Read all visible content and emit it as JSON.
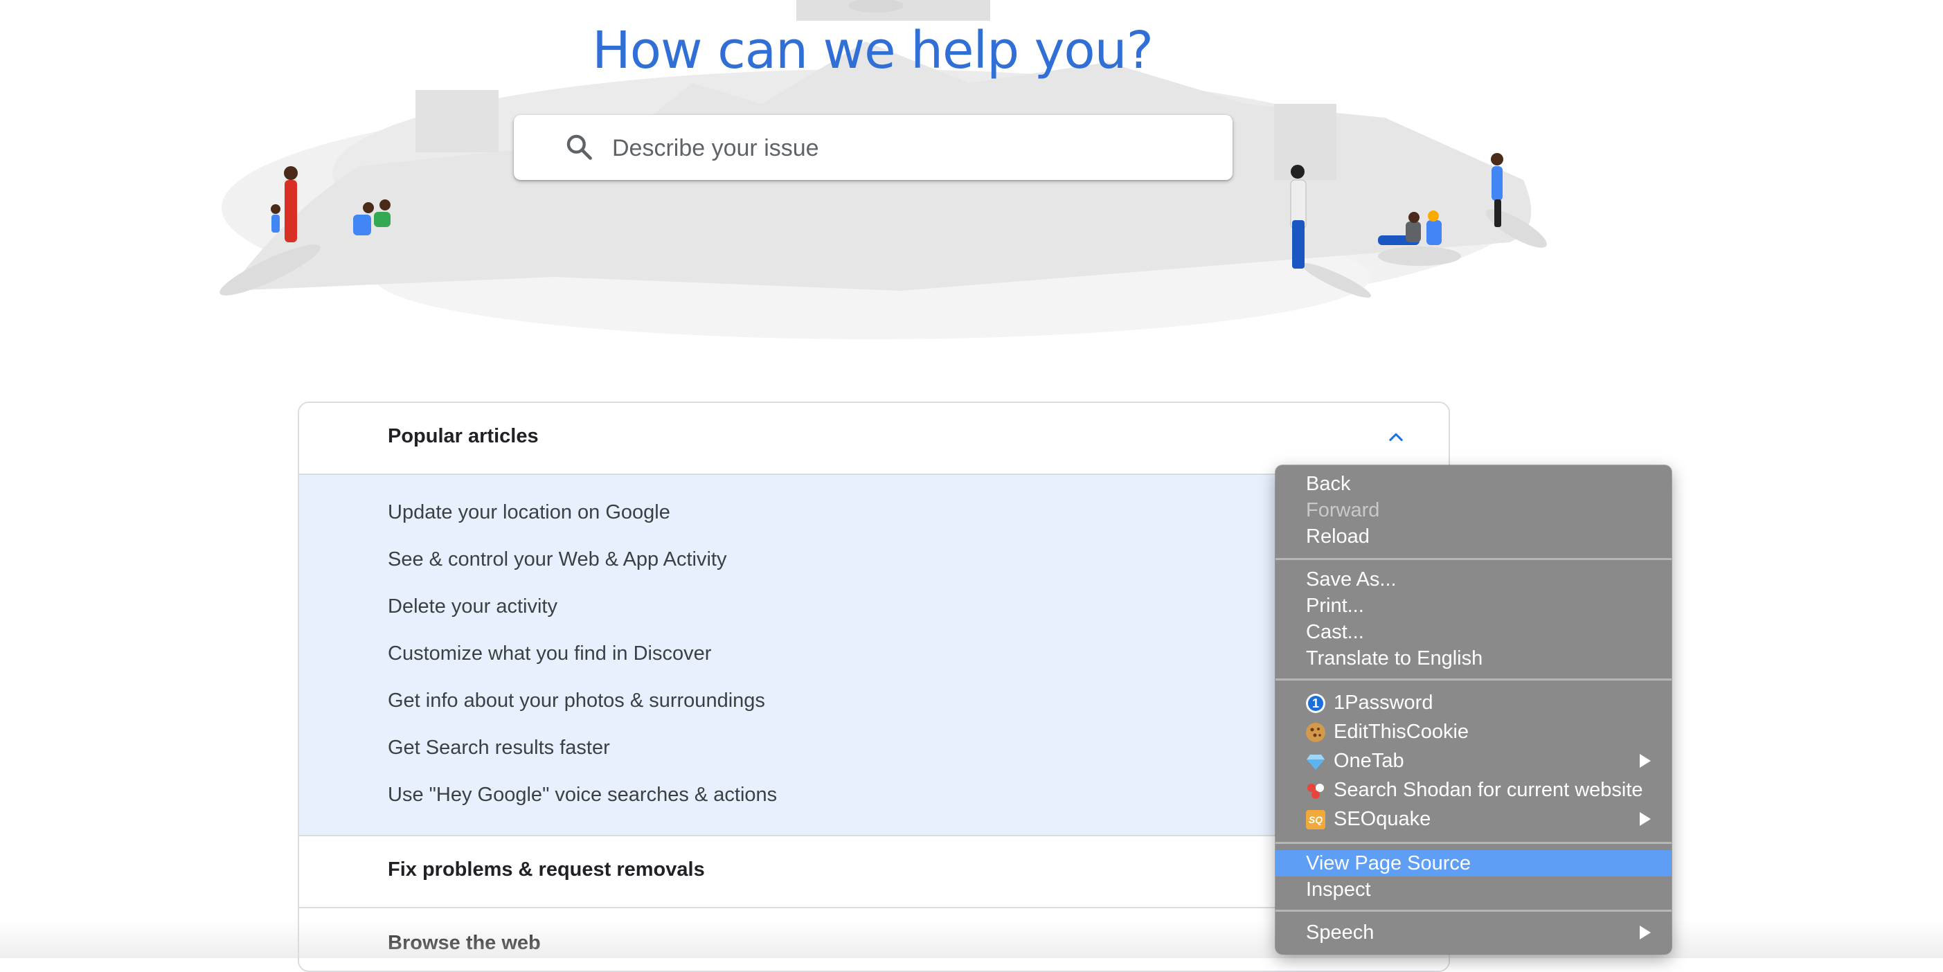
{
  "hero": {
    "title": "How can we help you?",
    "search_placeholder": "Describe your issue",
    "search_icon": "search-icon"
  },
  "sections": [
    {
      "label": "Popular articles",
      "expanded": true,
      "chevron_icon": "chevron-up-icon",
      "articles": [
        "Update your location on Google",
        "See & control your Web & App Activity",
        "Delete your activity",
        "Customize what you find in Discover",
        "Get info about your photos & surroundings",
        "Get Search results faster",
        "Use \"Hey Google\" voice searches & actions"
      ]
    },
    {
      "label": "Fix problems & request removals",
      "expanded": false
    },
    {
      "label": "Browse the web",
      "expanded": false
    }
  ],
  "context_menu": {
    "items": [
      {
        "label": "Back"
      },
      {
        "label": "Forward",
        "disabled": true
      },
      {
        "label": "Reload"
      },
      {
        "label": "Save As..."
      },
      {
        "label": "Print..."
      },
      {
        "label": "Cast..."
      },
      {
        "label": "Translate to English"
      },
      {
        "label": "1Password",
        "icon": "1password-icon"
      },
      {
        "label": "EditThisCookie",
        "icon": "cookie-icon"
      },
      {
        "label": "OneTab",
        "icon": "onetab-icon",
        "submenu": true
      },
      {
        "label": "Search Shodan for current website",
        "icon": "shodan-icon"
      },
      {
        "label": "SEOquake",
        "icon": "seoquake-icon",
        "submenu": true
      },
      {
        "label": "View Page Source",
        "highlighted": true
      },
      {
        "label": "Inspect"
      },
      {
        "label": "Speech",
        "submenu": true
      }
    ],
    "icon_glyphs": {
      "onepassword": "1",
      "seoquake": "SQ"
    }
  },
  "colors": {
    "title": "#2f6fd6",
    "menu_bg": "#8a8a8a",
    "menu_highlight": "#5e9ef5",
    "articles_bg": "#e8f0fe"
  }
}
